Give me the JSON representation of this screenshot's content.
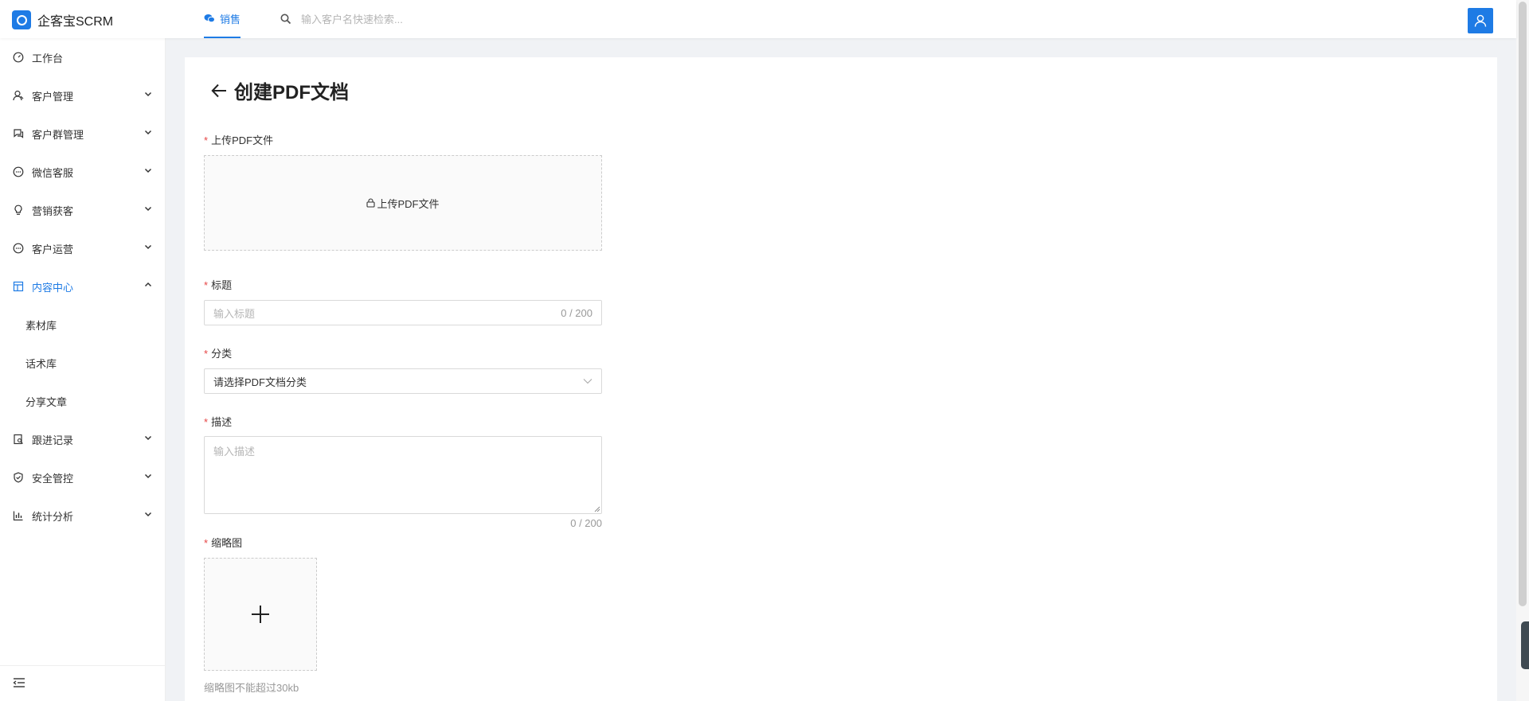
{
  "app": {
    "name": "企客宝SCRM"
  },
  "topnav": {
    "active_tab": "销售",
    "search_placeholder": "输入客户名快速检索..."
  },
  "sidebar": {
    "items": [
      {
        "label": "工作台",
        "icon": "dashboard-icon",
        "has_children": false
      },
      {
        "label": "客户管理",
        "icon": "customer-icon",
        "has_children": true
      },
      {
        "label": "客户群管理",
        "icon": "group-chat-icon",
        "has_children": true
      },
      {
        "label": "微信客服",
        "icon": "chat-icon",
        "has_children": true
      },
      {
        "label": "营销获客",
        "icon": "bulb-icon",
        "has_children": true
      },
      {
        "label": "客户运营",
        "icon": "operation-icon",
        "has_children": true
      },
      {
        "label": "内容中心",
        "icon": "content-icon",
        "has_children": true,
        "expanded": true,
        "active": true
      },
      {
        "label": "跟进记录",
        "icon": "record-icon",
        "has_children": true
      },
      {
        "label": "安全管控",
        "icon": "shield-icon",
        "has_children": true
      },
      {
        "label": "统计分析",
        "icon": "chart-icon",
        "has_children": true
      }
    ],
    "content_center_children": [
      "素材库",
      "话术库",
      "分享文章"
    ]
  },
  "page": {
    "title": "创建PDF文档",
    "form": {
      "upload": {
        "label": "上传PDF文件",
        "button_text": "上传PDF文件",
        "required": true
      },
      "title": {
        "label": "标题",
        "placeholder": "输入标题",
        "counter": "0 / 200",
        "required": true
      },
      "category": {
        "label": "分类",
        "value": "请选择PDF文档分类",
        "required": true
      },
      "description": {
        "label": "描述",
        "placeholder": "输入描述",
        "counter": "0 / 200",
        "required": true
      },
      "thumbnail": {
        "label": "缩略图",
        "hint": "缩略图不能超过30kb",
        "required": true
      }
    }
  },
  "colors": {
    "accent": "#1e7be5",
    "required": "#e64545",
    "background": "#f0f2f5"
  }
}
